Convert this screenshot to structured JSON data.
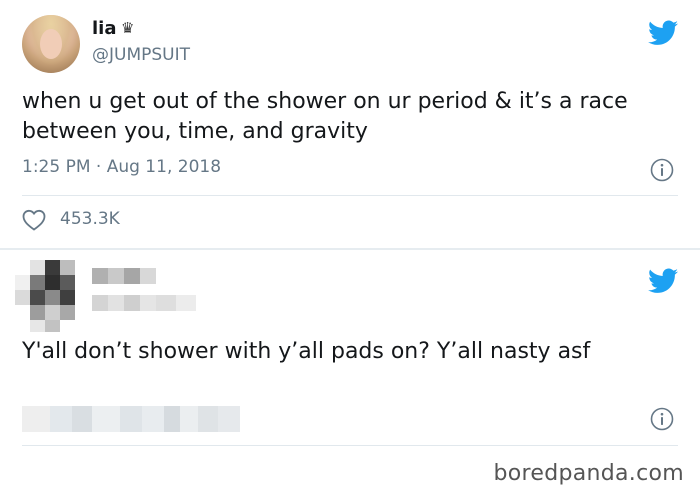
{
  "tweet1": {
    "display_name": "lia",
    "crown_glyph": "♛",
    "handle": "@JUMPSUIT",
    "text": "when u get out of the shower on ur period & it’s a race between you, time, and gravity",
    "timestamp": "1:25 PM · Aug 11, 2018",
    "likes": "453.3K",
    "icons": {
      "platform": "twitter-bird-icon",
      "info": "info-icon",
      "like": "heart-icon",
      "verified_extra": "crown-icon"
    }
  },
  "tweet2": {
    "text": "Y'all don’t shower with y’all pads on? Y’all nasty asf",
    "icons": {
      "platform": "twitter-bird-icon",
      "info": "info-icon"
    }
  },
  "watermark": "boredpanda.com",
  "colors": {
    "twitter_blue": "#1da1f2",
    "secondary_text": "#657786",
    "primary_text": "#14171a",
    "divider": "#e1e8ed",
    "background": "#e6ecf0"
  }
}
